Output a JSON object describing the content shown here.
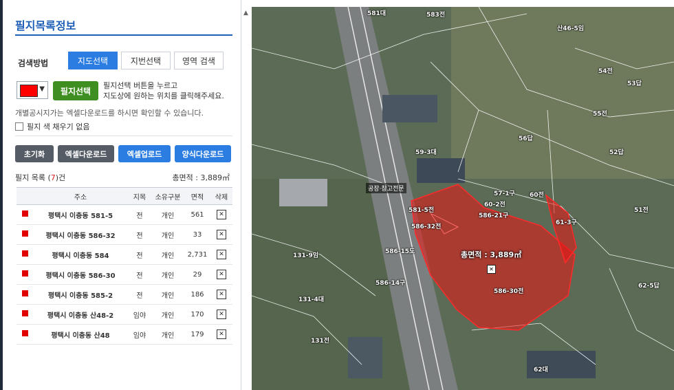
{
  "panel": {
    "title": "필지목록정보",
    "search_method_label": "검색방법",
    "tabs": [
      {
        "label": "지도선택",
        "active": true
      },
      {
        "label": "지번선택",
        "active": false
      },
      {
        "label": "영역 검색",
        "active": false
      }
    ],
    "fill_color": "#ff0000",
    "pick_button": "필지선택",
    "hint_line1": "필지선택 버튼을 누르고",
    "hint_line2": "지도상에 원하는 위치를 클릭해주세요.",
    "notice": "개별공시지가는 엑셀다운로드를 하시면 확인할 수 있습니다.",
    "no_fill_label": "필지 색 채우기 없음",
    "buttons": {
      "reset": "초기화",
      "excel_download": "엑셀다운로드",
      "excel_upload": "엑셀업로드",
      "form_download": "양식다운로드"
    },
    "list_label": "필지 목록 (",
    "list_count": "7",
    "list_suffix": ")건",
    "total_area": "총면적 : 3,889㎡"
  },
  "table": {
    "headers": [
      "",
      "주소",
      "지목",
      "소유구분",
      "면적",
      "삭제"
    ],
    "rows": [
      {
        "address": "평택시 이충동 581-5",
        "jimok": "전",
        "owner": "개인",
        "area": "561"
      },
      {
        "address": "평택시 이충동 586-32",
        "jimok": "전",
        "owner": "개인",
        "area": "33"
      },
      {
        "address": "평택시 이충동 584",
        "jimok": "전",
        "owner": "개인",
        "area": "2,731"
      },
      {
        "address": "평택시 이충동 586-30",
        "jimok": "전",
        "owner": "개인",
        "area": "29"
      },
      {
        "address": "평택시 이충동 585-2",
        "jimok": "전",
        "owner": "개인",
        "area": "186"
      },
      {
        "address": "평택시 이충동 산48-2",
        "jimok": "임야",
        "owner": "개인",
        "area": "170"
      },
      {
        "address": "평택시 이충동 산48",
        "jimok": "임야",
        "owner": "개인",
        "area": "179"
      }
    ],
    "delete_glyph": "✕"
  },
  "map": {
    "area_tag": "총면적 : 3,889㎡",
    "poi_label": "공장·창고전문",
    "parcel_labels": [
      "583전",
      "581대",
      "583전",
      "산46-5임",
      "54전",
      "53답",
      "55전",
      "56답",
      "52답",
      "51전",
      "60전",
      "61-3구",
      "62-5답",
      "62대",
      "586-30전",
      "586-15도",
      "586-14구",
      "131-4대",
      "131전",
      "131-9임",
      "59-3대",
      "586-21구",
      "60-2전",
      "57-1구",
      "586-32전",
      "581-5전"
    ]
  }
}
